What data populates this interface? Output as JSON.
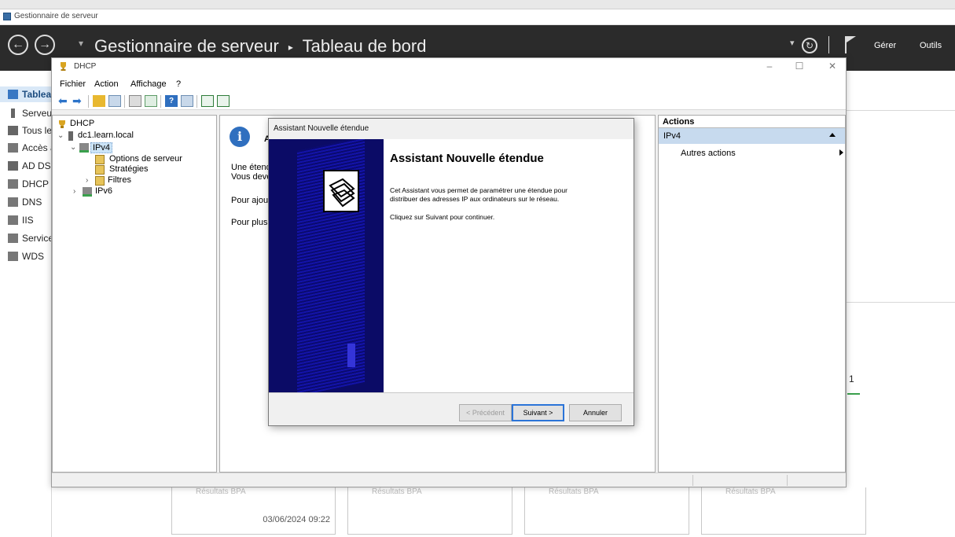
{
  "server_manager": {
    "window_title": "Gestionnaire de serveur",
    "breadcrumb": "Gestionnaire de serveur",
    "breadcrumb_sep": "▸",
    "page": "Tableau de bord",
    "menu_manage": "Gérer",
    "menu_tools": "Outils",
    "sidebar": [
      {
        "label": "Tableau de bord",
        "active": true
      },
      {
        "label": "Serveur local"
      },
      {
        "label": "Tous les serveurs"
      },
      {
        "label": "Accès à distance"
      },
      {
        "label": "AD DS"
      },
      {
        "label": "DHCP"
      },
      {
        "label": "DNS"
      },
      {
        "label": "IIS"
      },
      {
        "label": "Services de fichiers"
      },
      {
        "label": "WDS"
      }
    ],
    "tile_timestamp": "03/06/2024 09:22",
    "tile_caption": "Résultats BPA",
    "badge_count": "1"
  },
  "dhcp": {
    "title": "DHCP",
    "menu": [
      "Fichier",
      "Action",
      "Affichage",
      "?"
    ],
    "tree": {
      "root": "DHCP",
      "server": "dc1.learn.local",
      "ipv4": "IPv4",
      "server_options": "Options de serveur",
      "policies": "Stratégies",
      "filters": "Filtres",
      "ipv6": "IPv6"
    },
    "center": {
      "heading": "A",
      "line1": "Une étendue DHCP",
      "line2": "Vous devez définir",
      "line3": "Pour ajouter une étendue",
      "line4": "Pour plus d'informations"
    },
    "actions": {
      "header": "Actions",
      "section": "IPv4",
      "more": "Autres actions"
    }
  },
  "wizard": {
    "title": "Assistant Nouvelle étendue",
    "heading": "Assistant Nouvelle étendue",
    "body_line1": "Cet Assistant vous permet de paramétrer une étendue pour",
    "body_line2": "distribuer des adresses IP aux ordinateurs sur le réseau.",
    "body_line3": "Cliquez sur Suivant pour continuer.",
    "btn_prev": "< Précédent",
    "btn_next": "Suivant >",
    "btn_cancel": "Annuler"
  },
  "colors": {
    "header_bg": "#2b2b2b",
    "wizard_sidebar": "#0b0b66",
    "selection": "#cce4f7",
    "actions_section": "#c7daee"
  }
}
